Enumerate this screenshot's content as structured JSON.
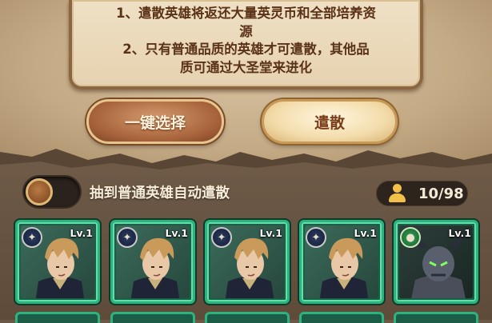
{
  "info": {
    "line1": "1、遣散英雄将返还大量英灵币和全部培养资",
    "line1b": "源",
    "line2": "2、只有普通品质的英雄才可遣散，其他品",
    "line2b": "质可通过大圣堂来进化"
  },
  "buttons": {
    "select_all": "一键选择",
    "disband": "遣散"
  },
  "auto_disband": {
    "label": "抽到普通英雄自动遣散",
    "enabled": false
  },
  "hero_count": "10/98",
  "cards": [
    {
      "level": "Lv.1",
      "badge_icon": "star-badge-icon",
      "hero": "brown-haired-hero"
    },
    {
      "level": "Lv.1",
      "badge_icon": "star-badge-icon",
      "hero": "brown-haired-hero"
    },
    {
      "level": "Lv.1",
      "badge_icon": "star-badge-icon",
      "hero": "brown-haired-hero"
    },
    {
      "level": "Lv.1",
      "badge_icon": "star-badge-icon",
      "hero": "brown-haired-hero"
    },
    {
      "level": "Lv.1",
      "badge_icon": "green-badge-icon",
      "hero": "horned-dark-hero"
    }
  ],
  "colors": {
    "card_border": "#2fb37e",
    "panel_text": "#5a3217",
    "count_icon": "#f2c14a"
  }
}
